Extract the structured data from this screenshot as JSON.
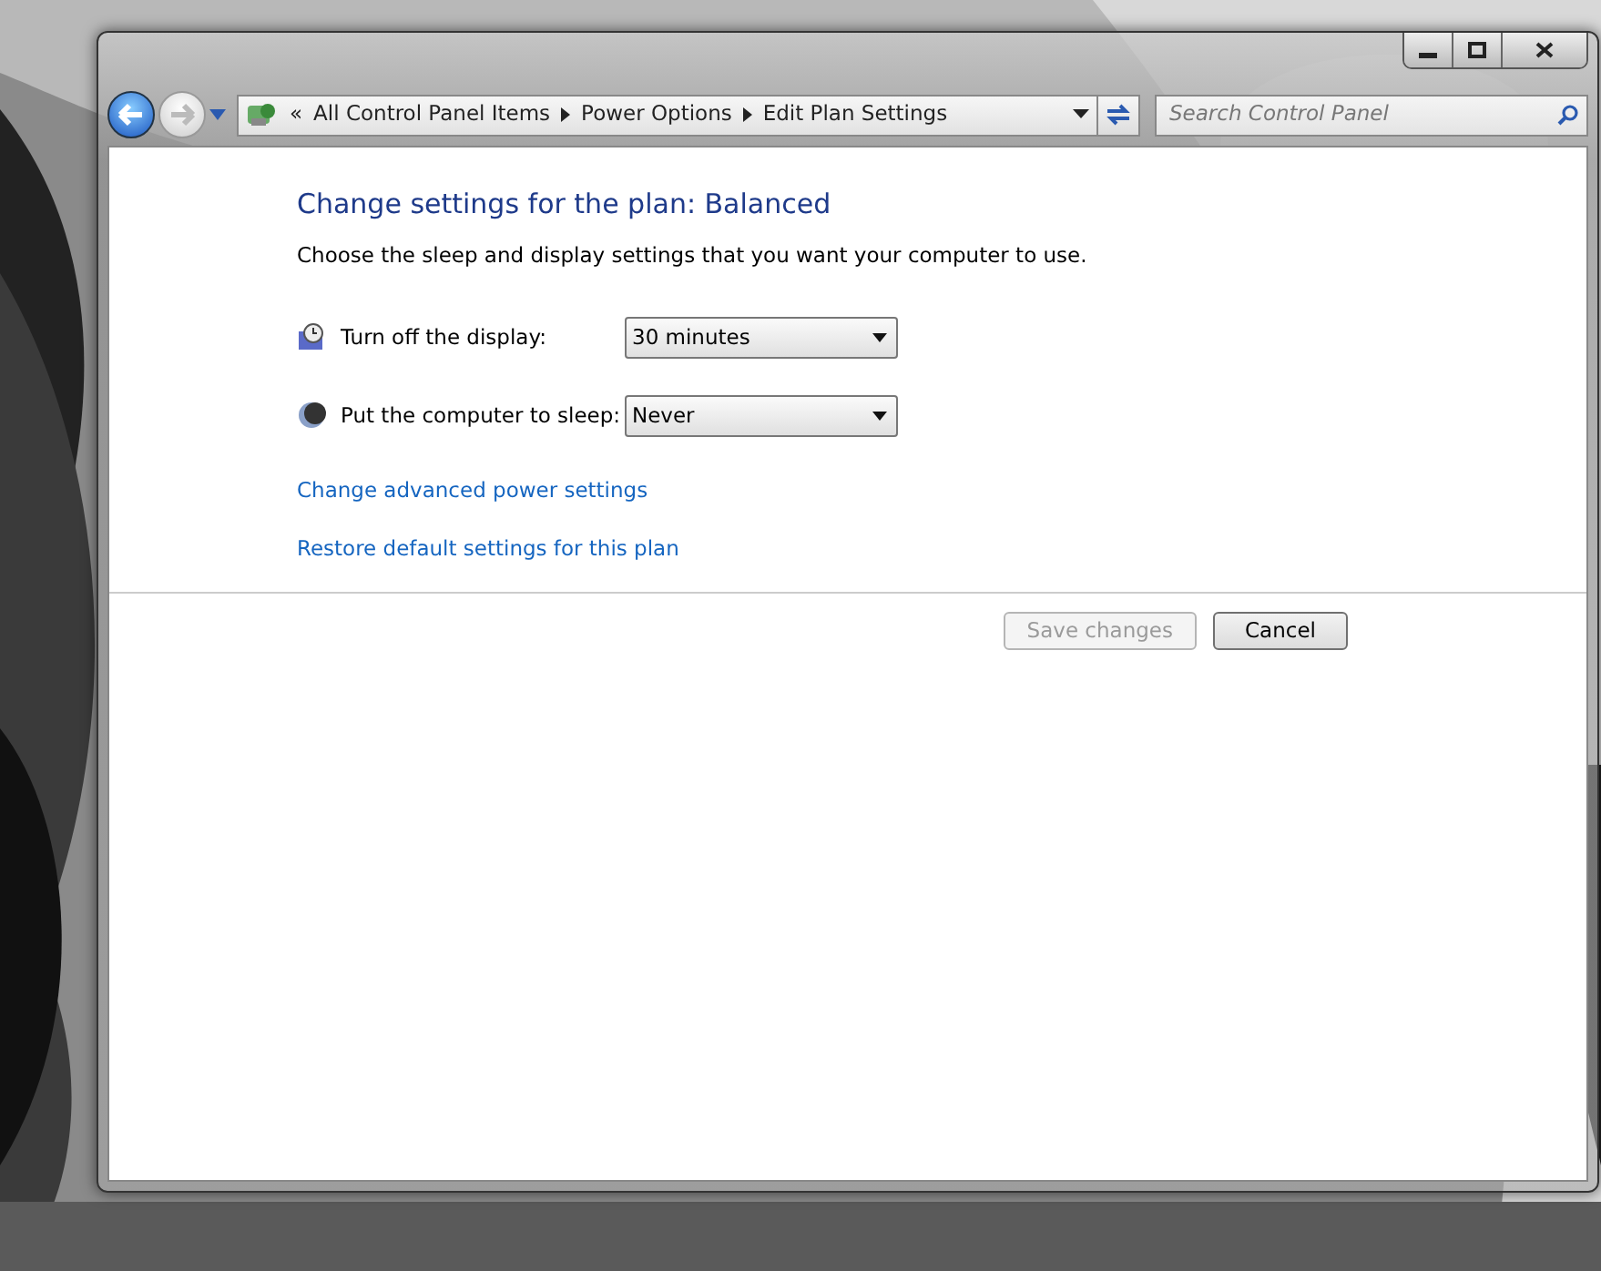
{
  "nav_buttons": [
    {
      "kind": "back",
      "disabled": false
    },
    {
      "kind": "forward",
      "disabled": true
    }
  ],
  "address_bar": {
    "overflow": "«",
    "breadcrumbs": [
      "All Control Panel Items",
      "Power Options",
      "Edit Plan Settings"
    ]
  },
  "search": {
    "placeholder": "Search Control Panel"
  },
  "content": {
    "title": "Change settings for the plan: Balanced",
    "description": "Choose the sleep and display settings that you want your computer to use.",
    "settings": [
      {
        "kind": "display",
        "label": "Turn off the display:",
        "value": "30 minutes"
      },
      {
        "kind": "sleep",
        "label": "Put the computer to sleep:",
        "value": "Never"
      }
    ],
    "links": [
      "Change advanced power settings",
      "Restore default settings for this plan"
    ],
    "buttons": [
      {
        "label": "Save changes",
        "disabled": true
      },
      {
        "label": "Cancel",
        "disabled": false
      }
    ]
  }
}
